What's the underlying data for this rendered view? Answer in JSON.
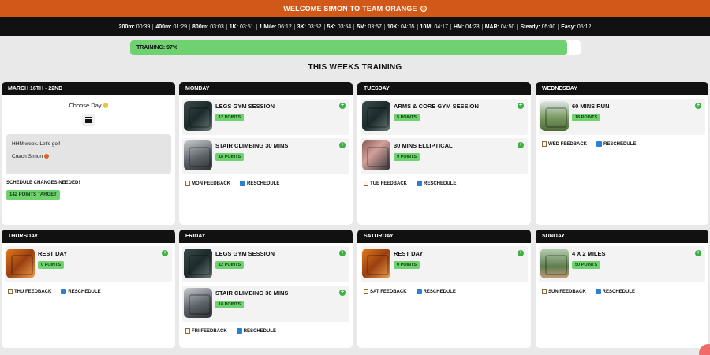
{
  "header": {
    "title": "WELCOME SIMON TO TEAM ORANGE"
  },
  "paces": [
    {
      "label": "200m:",
      "value": "00:39"
    },
    {
      "label": "400m:",
      "value": "01:29"
    },
    {
      "label": "800m:",
      "value": "03:03"
    },
    {
      "label": "1K:",
      "value": "03:51"
    },
    {
      "label": "1 Mile:",
      "value": "06:12"
    },
    {
      "label": "3K:",
      "value": "03:52"
    },
    {
      "label": "5K:",
      "value": "03:54"
    },
    {
      "label": "5M:",
      "value": "03:57"
    },
    {
      "label": "10K:",
      "value": "04:05"
    },
    {
      "label": "10M:",
      "value": "04:17"
    },
    {
      "label": "HM:",
      "value": "04:23"
    },
    {
      "label": "MAR:",
      "value": "04:50"
    },
    {
      "label": "Steady:",
      "value": "05:00"
    },
    {
      "label": "Easy:",
      "value": "05:12"
    }
  ],
  "progress": {
    "label": "TRAINING: 97%",
    "percent": 97
  },
  "section_title": "THIS WEEKS TRAINING",
  "week_card": {
    "header": "MARCH 16TH - 22ND",
    "choose_label": "Choose Day",
    "note_line1": "HHM week. Let's go!!",
    "note_line2": "Coach Simon",
    "changes_label": "SCHEDULE CHANGES NEEDED!",
    "target_label": "142 POINTS TARGET"
  },
  "days": {
    "mon": {
      "name": "MONDAY",
      "feedback": "MON FEEDBACK",
      "reschedule": "RESCHEDULE",
      "sessions": [
        {
          "title": "LEGS GYM SESSION",
          "points": "12 POINTS"
        },
        {
          "title": "STAIR CLIMBING 30 MINS",
          "points": "18 POINTS"
        }
      ]
    },
    "tue": {
      "name": "TUESDAY",
      "feedback": "TUE FEEDBACK",
      "reschedule": "RESCHEDULE",
      "sessions": [
        {
          "title": "ARMS & CORE GYM SESSION",
          "points": "5 POINTS"
        },
        {
          "title": "30 MINS ELLIPTICAL",
          "points": "9 POINTS"
        }
      ]
    },
    "wed": {
      "name": "WEDNESDAY",
      "feedback": "WED FEEDBACK",
      "reschedule": "RESCHEDULE",
      "sessions": [
        {
          "title": "60 MINS RUN",
          "points": "18 POINTS"
        }
      ]
    },
    "thu": {
      "name": "THURSDAY",
      "feedback": "THU FEEDBACK",
      "reschedule": "RESCHEDULE",
      "sessions": [
        {
          "title": "REST DAY",
          "points": "0 POINTS"
        }
      ]
    },
    "fri": {
      "name": "FRIDAY",
      "feedback": "FRI FEEDBACK",
      "reschedule": "RESCHEDULE",
      "sessions": [
        {
          "title": "LEGS GYM SESSION",
          "points": "12 POINTS"
        },
        {
          "title": "STAIR CLIMBING 30 MINS",
          "points": "18 POINTS"
        }
      ]
    },
    "sat": {
      "name": "SATURDAY",
      "feedback": "SAT FEEDBACK",
      "reschedule": "RESCHEDULE",
      "sessions": [
        {
          "title": "REST DAY",
          "points": "0 POINTS"
        }
      ]
    },
    "sun": {
      "name": "SUNDAY",
      "feedback": "SUN FEEDBACK",
      "reschedule": "RESCHEDULE",
      "sessions": [
        {
          "title": "4 X 2 MILES",
          "points": "50 POINTS"
        }
      ]
    }
  },
  "colors": {
    "brand": "#d2581a",
    "accent_green": "#6fd16f",
    "dark": "#111111"
  },
  "icons": [
    "orange-icon",
    "hand-point-icon",
    "menu-icon",
    "add-circle-icon",
    "feedback-doc-icon",
    "calendar-icon"
  ]
}
